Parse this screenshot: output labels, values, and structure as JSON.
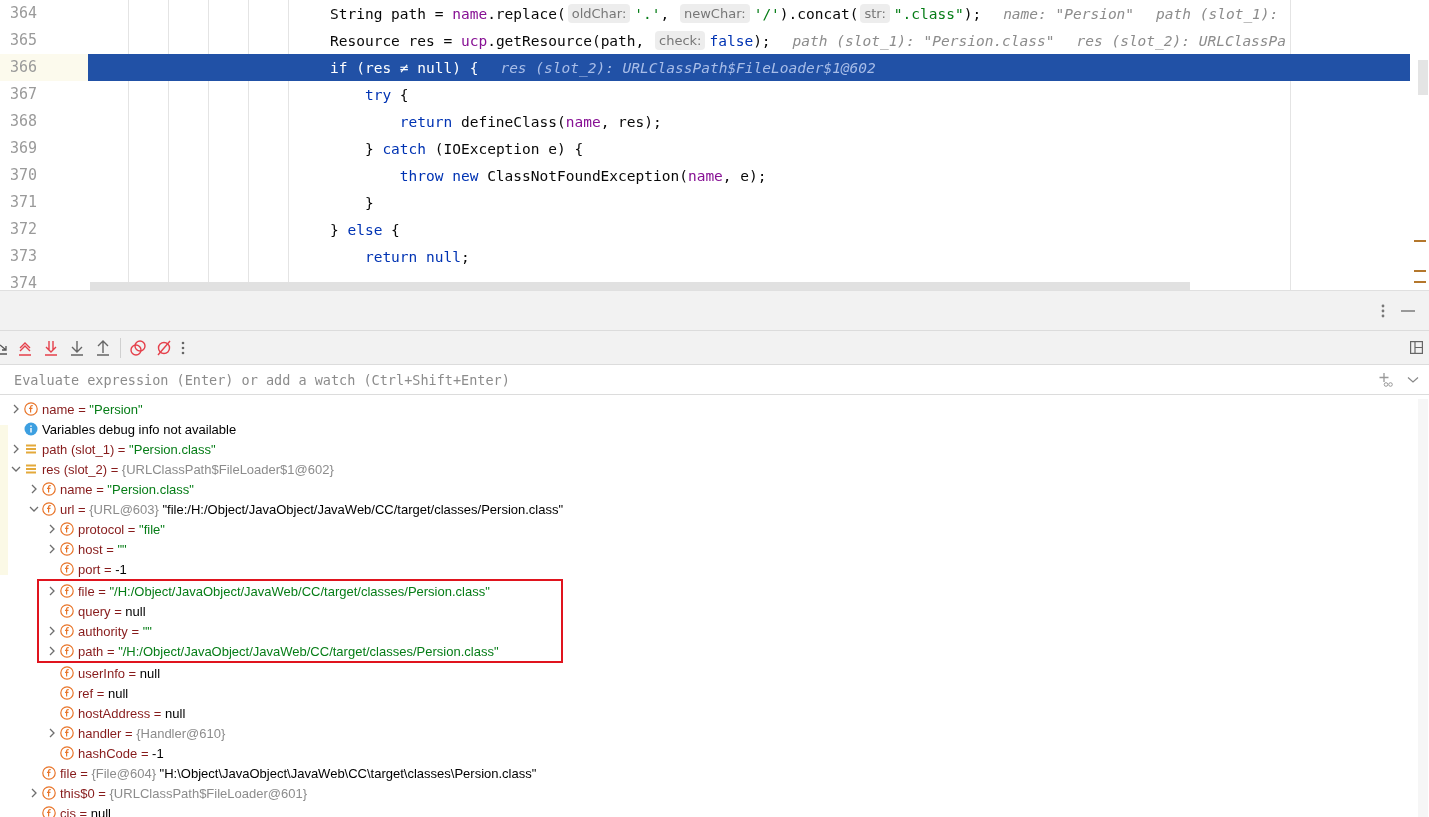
{
  "editor": {
    "lines": [
      {
        "number": "364",
        "selected": false,
        "tokens": [
          {
            "kind": "plain",
            "text": "String path = "
          },
          {
            "kind": "field",
            "text": "name"
          },
          {
            "kind": "plain",
            "text": ".replace("
          },
          {
            "kind": "hint",
            "text": "oldChar:"
          },
          {
            "kind": "string",
            "text": "'.'"
          },
          {
            "kind": "plain",
            "text": ", "
          },
          {
            "kind": "hint",
            "text": "newChar:"
          },
          {
            "kind": "string",
            "text": "'/'"
          },
          {
            "kind": "plain",
            "text": ").concat("
          },
          {
            "kind": "hint",
            "text": "str:"
          },
          {
            "kind": "string",
            "text": "\".class\""
          },
          {
            "kind": "plain",
            "text": ");"
          },
          {
            "kind": "inlay",
            "text": "name: \"Persion\""
          },
          {
            "kind": "inlay",
            "text": "path (slot_1):"
          }
        ]
      },
      {
        "number": "365",
        "selected": false,
        "tokens": [
          {
            "kind": "plain",
            "text": "Resource res = "
          },
          {
            "kind": "field",
            "text": "ucp"
          },
          {
            "kind": "plain",
            "text": ".getResource(path, "
          },
          {
            "kind": "hint",
            "text": "check:"
          },
          {
            "kind": "keyword",
            "text": "false"
          },
          {
            "kind": "plain",
            "text": ");"
          },
          {
            "kind": "inlay",
            "text": "path (slot_1): \"Persion.class\""
          },
          {
            "kind": "inlay",
            "text": "res (slot_2): URLClassPa"
          }
        ]
      },
      {
        "number": "366",
        "selected": true,
        "tokens": [
          {
            "kind": "plain",
            "text": "if (res ≠ null) {"
          },
          {
            "kind": "inlay",
            "text": "res (slot_2): URLClassPath$FileLoader$1@602"
          }
        ]
      },
      {
        "number": "367",
        "selected": false,
        "tokens": [
          {
            "kind": "keyword",
            "text": "    try"
          },
          {
            "kind": "plain",
            "text": " {"
          }
        ]
      },
      {
        "number": "368",
        "selected": false,
        "tokens": [
          {
            "kind": "keyword",
            "text": "        return"
          },
          {
            "kind": "plain",
            "text": " defineClass("
          },
          {
            "kind": "field",
            "text": "name"
          },
          {
            "kind": "plain",
            "text": ", res);"
          }
        ]
      },
      {
        "number": "369",
        "selected": false,
        "tokens": [
          {
            "kind": "plain",
            "text": "    } "
          },
          {
            "kind": "keyword",
            "text": "catch"
          },
          {
            "kind": "plain",
            "text": " (IOException e) {"
          }
        ]
      },
      {
        "number": "370",
        "selected": false,
        "tokens": [
          {
            "kind": "keyword",
            "text": "        throw new"
          },
          {
            "kind": "plain",
            "text": " ClassNotFoundException("
          },
          {
            "kind": "field",
            "text": "name"
          },
          {
            "kind": "plain",
            "text": ", e);"
          }
        ]
      },
      {
        "number": "371",
        "selected": false,
        "tokens": [
          {
            "kind": "plain",
            "text": "    }"
          }
        ]
      },
      {
        "number": "372",
        "selected": false,
        "tokens": [
          {
            "kind": "plain",
            "text": "} "
          },
          {
            "kind": "keyword",
            "text": "else"
          },
          {
            "kind": "plain",
            "text": " {"
          }
        ]
      },
      {
        "number": "373",
        "selected": false,
        "tokens": [
          {
            "kind": "keyword",
            "text": "    return null"
          },
          {
            "kind": "plain",
            "text": ";"
          }
        ]
      },
      {
        "number": "374",
        "selected": false
      }
    ]
  },
  "evaluate": {
    "placeholder": "Evaluate expression (Enter) or add a watch (Ctrl+Shift+Enter)"
  },
  "variables": [
    {
      "kind": "field",
      "expanded": false,
      "name": "name =",
      "value": {
        "kind": "string",
        "text": "\"Persion\""
      }
    },
    {
      "kind": "info",
      "text": "Variables debug info not available"
    },
    {
      "kind": "local",
      "expanded": false,
      "name": "path (slot_1) =",
      "value": {
        "kind": "string",
        "text": "\"Persion.class\""
      }
    },
    {
      "kind": "local",
      "expanded": true,
      "name": "res (slot_2) =",
      "ref": "{URLClassPath$FileLoader$1@602}",
      "children": [
        {
          "kind": "field",
          "expanded": false,
          "name": "name =",
          "value": {
            "kind": "string",
            "text": "\"Persion.class\""
          }
        },
        {
          "kind": "field",
          "expanded": true,
          "name": "url =",
          "ref": "{URL@603}",
          "value": {
            "kind": "plain",
            "text": "\"file:/H:/Object/JavaObject/JavaWeb/CC/target/classes/Persion.class\""
          },
          "children": [
            {
              "kind": "field",
              "expanded": false,
              "name": "protocol =",
              "value": {
                "kind": "string",
                "text": "\"file\""
              },
              "highlighted": false
            },
            {
              "kind": "field",
              "expanded": false,
              "name": "host =",
              "value": {
                "kind": "string",
                "text": "\"\""
              },
              "highlighted": false
            },
            {
              "kind": "field",
              "name": "port =",
              "value": {
                "kind": "plain",
                "text": "-1"
              },
              "highlighted": false
            },
            {
              "kind": "field",
              "expanded": false,
              "name": "file =",
              "value": {
                "kind": "string",
                "text": "\"/H:/Object/JavaObject/JavaWeb/CC/target/classes/Persion.class\""
              },
              "highlighted": true
            },
            {
              "kind": "field",
              "name": "query =",
              "value": {
                "kind": "plain",
                "text": "null"
              },
              "highlighted": true
            },
            {
              "kind": "field",
              "expanded": false,
              "name": "authority =",
              "value": {
                "kind": "string",
                "text": "\"\""
              },
              "highlighted": true
            },
            {
              "kind": "field",
              "expanded": false,
              "name": "path =",
              "value": {
                "kind": "string",
                "text": "\"/H:/Object/JavaObject/JavaWeb/CC/target/classes/Persion.class\""
              },
              "highlighted": true
            },
            {
              "kind": "field",
              "name": "userInfo =",
              "value": {
                "kind": "plain",
                "text": "null"
              },
              "highlighted": false
            },
            {
              "kind": "field",
              "name": "ref =",
              "value": {
                "kind": "plain",
                "text": "null"
              },
              "highlighted": false
            },
            {
              "kind": "field",
              "name": "hostAddress =",
              "value": {
                "kind": "plain",
                "text": "null"
              },
              "highlighted": false
            },
            {
              "kind": "field",
              "expanded": false,
              "name": "handler =",
              "ref": "{Handler@610}",
              "highlighted": false
            },
            {
              "kind": "field",
              "name": "hashCode =",
              "value": {
                "kind": "plain",
                "text": "-1"
              },
              "highlighted": false
            }
          ]
        },
        {
          "kind": "field",
          "name": "file =",
          "ref": "{File@604}",
          "value": {
            "kind": "plain",
            "text": "\"H:\\Object\\JavaObject\\JavaWeb\\CC\\target\\classes\\Persion.class\""
          }
        },
        {
          "kind": "field",
          "expanded": false,
          "name": "this$0 =",
          "ref": "{URLClassPath$FileLoader@601}"
        },
        {
          "kind": "field",
          "name": "cis =",
          "value": {
            "kind": "plain",
            "text": "null"
          }
        }
      ]
    }
  ]
}
